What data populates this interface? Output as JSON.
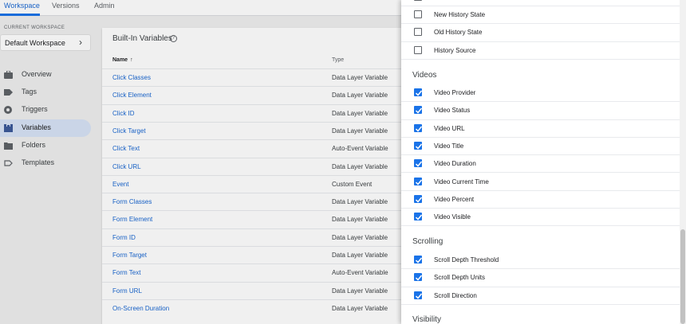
{
  "tabs": [
    {
      "label": "Workspace",
      "active": true
    },
    {
      "label": "Versions",
      "active": false
    },
    {
      "label": "Admin",
      "active": false
    }
  ],
  "workspace": {
    "section_label": "CURRENT WORKSPACE",
    "name": "Default Workspace"
  },
  "nav": [
    {
      "label": "Overview",
      "icon": "briefcase-icon",
      "active": false
    },
    {
      "label": "Tags",
      "icon": "tag-icon",
      "active": false
    },
    {
      "label": "Triggers",
      "icon": "trigger-icon",
      "active": false
    },
    {
      "label": "Variables",
      "icon": "variables-icon",
      "active": true
    },
    {
      "label": "Folders",
      "icon": "folder-icon",
      "active": false
    },
    {
      "label": "Templates",
      "icon": "template-icon",
      "active": false
    }
  ],
  "table": {
    "title": "Built-In Variables",
    "columns": {
      "name": "Name",
      "type": "Type"
    },
    "rows": [
      {
        "name": "Click Classes",
        "type": "Data Layer Variable"
      },
      {
        "name": "Click Element",
        "type": "Data Layer Variable"
      },
      {
        "name": "Click ID",
        "type": "Data Layer Variable"
      },
      {
        "name": "Click Target",
        "type": "Data Layer Variable"
      },
      {
        "name": "Click Text",
        "type": "Auto-Event Variable"
      },
      {
        "name": "Click URL",
        "type": "Data Layer Variable"
      },
      {
        "name": "Event",
        "type": "Custom Event"
      },
      {
        "name": "Form Classes",
        "type": "Data Layer Variable"
      },
      {
        "name": "Form Element",
        "type": "Data Layer Variable"
      },
      {
        "name": "Form ID",
        "type": "Data Layer Variable"
      },
      {
        "name": "Form Target",
        "type": "Data Layer Variable"
      },
      {
        "name": "Form Text",
        "type": "Auto-Event Variable"
      },
      {
        "name": "Form URL",
        "type": "Data Layer Variable"
      },
      {
        "name": "On-Screen Duration",
        "type": "Data Layer Variable"
      }
    ]
  },
  "drawer": {
    "history_options": [
      {
        "label": "New History State",
        "checked": false
      },
      {
        "label": "Old History State",
        "checked": false
      },
      {
        "label": "History Source",
        "checked": false
      }
    ],
    "videos": {
      "title": "Videos",
      "options": [
        {
          "label": "Video Provider",
          "checked": true
        },
        {
          "label": "Video Status",
          "checked": true
        },
        {
          "label": "Video URL",
          "checked": true
        },
        {
          "label": "Video Title",
          "checked": true
        },
        {
          "label": "Video Duration",
          "checked": true
        },
        {
          "label": "Video Current Time",
          "checked": true
        },
        {
          "label": "Video Percent",
          "checked": true
        },
        {
          "label": "Video Visible",
          "checked": true
        }
      ]
    },
    "scrolling": {
      "title": "Scrolling",
      "options": [
        {
          "label": "Scroll Depth Threshold",
          "checked": true
        },
        {
          "label": "Scroll Depth Units",
          "checked": true
        },
        {
          "label": "Scroll Direction",
          "checked": true
        }
      ]
    },
    "visibility": {
      "title": "Visibility"
    }
  },
  "colors": {
    "accent": "#1a73e8",
    "link": "#1967d2",
    "nav_active_bg": "#d7e3f6"
  }
}
